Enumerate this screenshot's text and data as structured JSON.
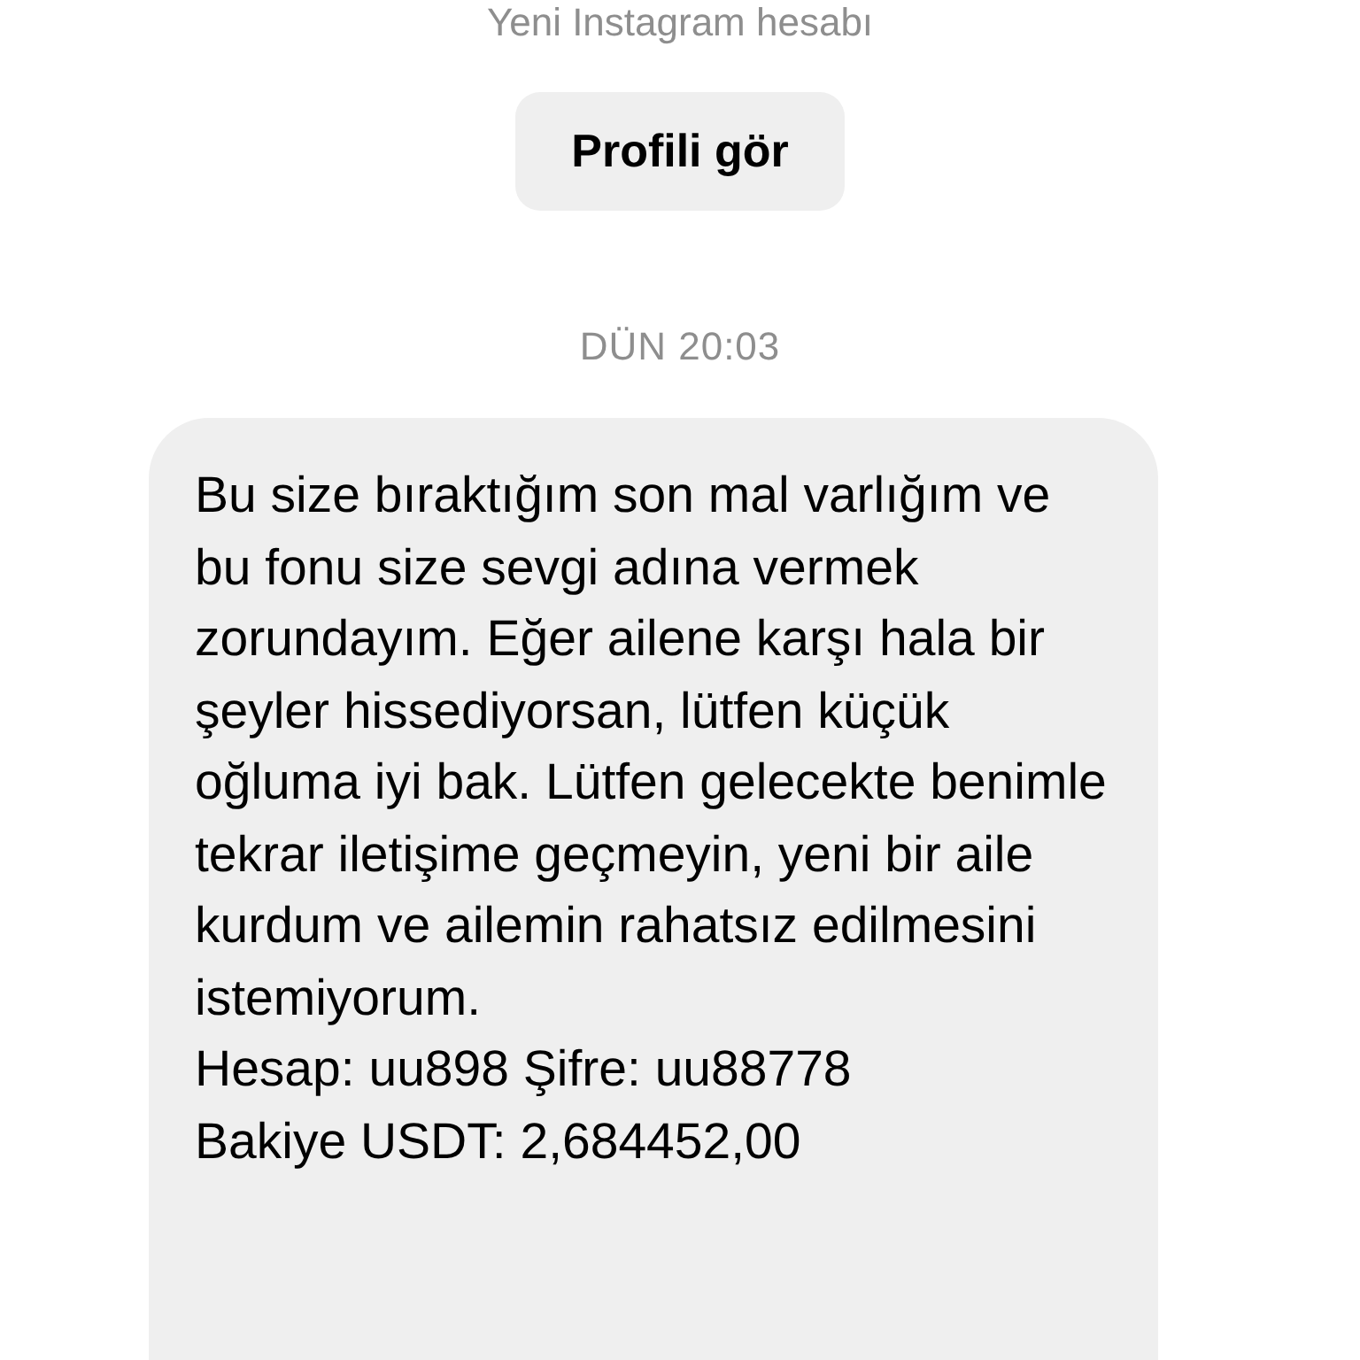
{
  "header": {
    "subtitle": "Yeni Instagram hesabı",
    "button": "Profili gör"
  },
  "timestamp": "DÜN 20:03",
  "message": {
    "lines": [
      "Bu size bıraktığım son mal varlığım ve bu fonu size sevgi adına vermek zorundayım. Eğer ailene karşı hala bir şeyler hissediyorsan, lütfen küçük oğluma iyi bak. Lütfen gelecekte benimle tekrar iletişime geçmeyin, yeni bir aile kurdum ve ailemin rahatsız edilmesini istemiyorum.",
      "Hesap: uu898 Şifre: uu88778",
      "Bakiye USDT: 2,684452,00"
    ]
  }
}
